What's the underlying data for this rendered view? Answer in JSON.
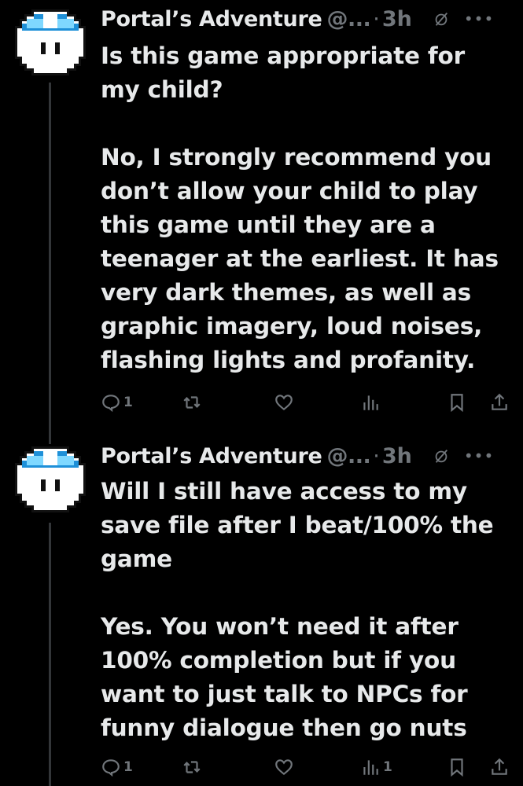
{
  "posts": [
    {
      "author_name": "Portal’s Adventure",
      "handle": "@...",
      "time": "3h",
      "text": "Is this game appropriate for my child?\n\nNo, I strongly recommend you don’t allow your child to play this game until they are a teenager at the earliest. It has very dark themes, as well as graphic imagery, loud noises, flashing lights and profanity.",
      "replies": "1",
      "reposts": "",
      "likes": "",
      "views": ""
    },
    {
      "author_name": "Portal’s Adventure",
      "handle": "@...",
      "time": "3h",
      "text": "Will I still have access to my save file after I beat/100% the game\n\nYes. You won’t need it after 100% completion but if you want to just talk to NPCs for funny dialogue then go nuts",
      "replies": "1",
      "reposts": "",
      "likes": "",
      "views": "1"
    }
  ],
  "icons": {
    "reply": "reply-icon",
    "repost": "repost-icon",
    "like": "heart-icon",
    "views": "views-icon",
    "bookmark": "bookmark-icon",
    "share": "share-icon",
    "grok": "grok-icon",
    "more": "more-icon"
  },
  "colors": {
    "background": "#000000",
    "text": "#e7e9ea",
    "muted": "#71767b",
    "avatar_blue": "#2aa8f0"
  }
}
